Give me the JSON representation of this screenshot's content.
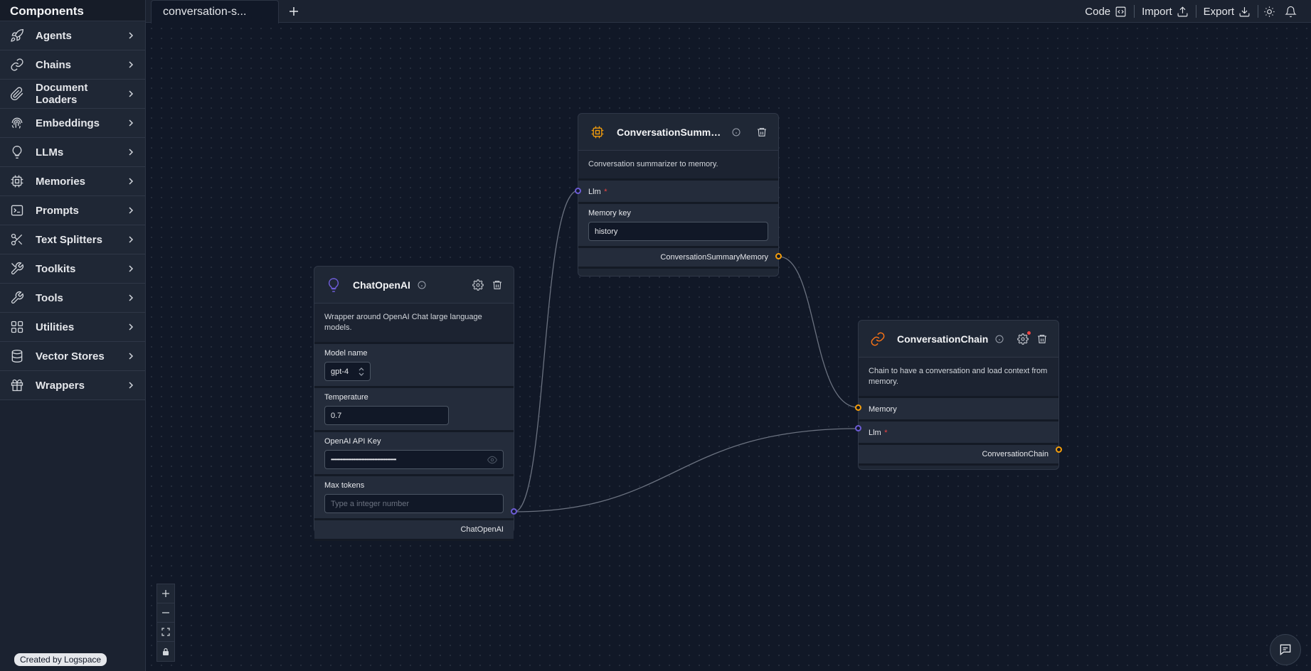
{
  "sidebar": {
    "title": "Components",
    "items": [
      {
        "label": "Agents",
        "icon": "rocket-icon"
      },
      {
        "label": "Chains",
        "icon": "link-icon"
      },
      {
        "label": "Document Loaders",
        "icon": "paperclip-icon"
      },
      {
        "label": "Embeddings",
        "icon": "fingerprint-icon"
      },
      {
        "label": "LLMs",
        "icon": "lightbulb-icon"
      },
      {
        "label": "Memories",
        "icon": "cpu-icon"
      },
      {
        "label": "Prompts",
        "icon": "terminal-icon"
      },
      {
        "label": "Text Splitters",
        "icon": "scissors-icon"
      },
      {
        "label": "Toolkits",
        "icon": "toolkit-icon"
      },
      {
        "label": "Tools",
        "icon": "wrench-icon"
      },
      {
        "label": "Utilities",
        "icon": "grid-icon"
      },
      {
        "label": "Vector Stores",
        "icon": "database-icon"
      },
      {
        "label": "Wrappers",
        "icon": "gift-icon"
      }
    ],
    "credit": "Created by Logspace"
  },
  "topbar": {
    "tab_label": "conversation-s...",
    "code_label": "Code",
    "import_label": "Import",
    "export_label": "Export"
  },
  "nodes": {
    "memory": {
      "title": "ConversationSummary...",
      "description": "Conversation summarizer to memory.",
      "llm_label": "Llm",
      "required_mark": "*",
      "memory_key_label": "Memory key",
      "memory_key_value": "history",
      "output_label": "ConversationSummaryMemory"
    },
    "llm": {
      "title": "ChatOpenAI",
      "description": "Wrapper around OpenAI Chat large language models.",
      "model_label": "Model name",
      "model_value": "gpt-4",
      "temperature_label": "Temperature",
      "temperature_value": "0.7",
      "api_key_label": "OpenAI API Key",
      "api_key_value": "•••••••••••••••••••••••••••••••••••••••••••••••••••",
      "max_tokens_label": "Max tokens",
      "max_tokens_placeholder": "Type a integer number",
      "output_label": "ChatOpenAI"
    },
    "chain": {
      "title": "ConversationChain",
      "description": "Chain to have a conversation and load context from memory.",
      "memory_label": "Memory",
      "llm_label": "Llm",
      "required_mark": "*",
      "output_label": "ConversationChain"
    }
  },
  "colors": {
    "accent_purple": "#6d5cd6",
    "accent_orange": "#f59e0b",
    "required_red": "#ef4444",
    "background": "#111827"
  }
}
